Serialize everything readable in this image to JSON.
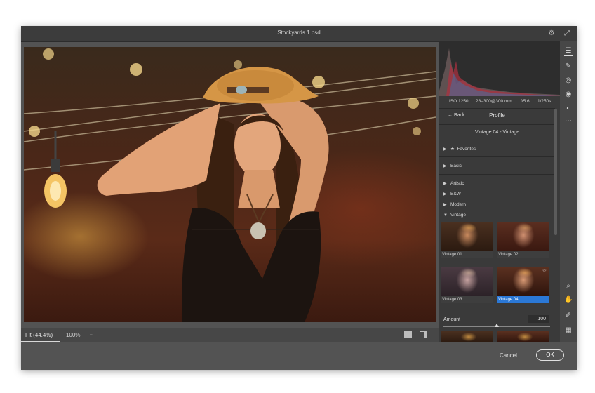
{
  "window": {
    "title": "Stockyards 1.psd"
  },
  "titlebar_icons": [
    "gear-icon",
    "expand-icon"
  ],
  "panel": {
    "exif": {
      "iso": "ISO 1250",
      "focal": "28–300@300 mm",
      "aperture": "f/5.6",
      "shutter": "1/250s"
    },
    "back_label": "Back",
    "profile_title": "Profile",
    "more_label": "···",
    "current_profile": "Vintage 04 - Vintage",
    "groups": [
      {
        "label": "Favorites",
        "star": "★"
      },
      {
        "label": "Basic"
      },
      {
        "label": "Artistic"
      },
      {
        "label": "B&W"
      },
      {
        "label": "Modern"
      },
      {
        "label": "Vintage"
      }
    ],
    "thumbnails": [
      {
        "label": "Vintage 01"
      },
      {
        "label": "Vintage 02"
      },
      {
        "label": "Vintage 03"
      },
      {
        "label": "Vintage 04",
        "selected": true
      }
    ],
    "amount": {
      "label": "Amount",
      "value": "100",
      "fraction": 0.5
    }
  },
  "bottombar": {
    "zoom_fit": "Fit (44.4%)",
    "zoom_100": "100%",
    "zoom_caret": "⌄"
  },
  "footer": {
    "cancel_label": "Cancel",
    "ok_label": "OK"
  },
  "toolstrip": [
    "sliders-icon",
    "brush-icon",
    "circle-select-icon",
    "redeye-icon",
    "presets-icon",
    "more-icon",
    "zoom-icon",
    "hand-icon",
    "eyedropper-icon",
    "grid-icon"
  ],
  "colors": {
    "accent": "#2b78d6",
    "window_bg": "#535353",
    "panel_bg": "#3a3a3a"
  }
}
